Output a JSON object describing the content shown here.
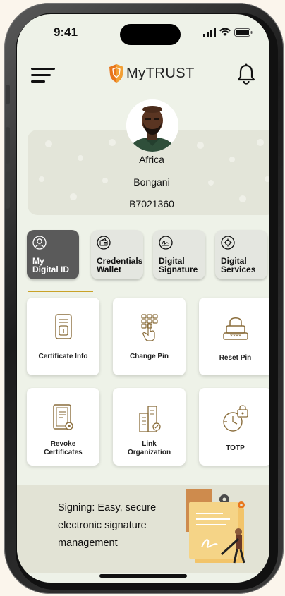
{
  "status_bar": {
    "time": "9:41"
  },
  "header": {
    "app_name": "MyTRUST"
  },
  "profile": {
    "first_name": "Africa",
    "last_name": "Bongani",
    "id_number": "B7021360"
  },
  "tabs": [
    {
      "label_line1": "My",
      "label_line2": "Digital ID",
      "icon": "user-icon",
      "active": true
    },
    {
      "label_line1": "Credentials",
      "label_line2": "Wallet",
      "icon": "wallet-icon",
      "active": false
    },
    {
      "label_line1": "Digital",
      "label_line2": "Signature",
      "icon": "signature-icon",
      "active": false
    },
    {
      "label_line1": "Digital",
      "label_line2": "Services",
      "icon": "services-icon",
      "active": false
    }
  ],
  "actions": [
    {
      "label_line1": "Certificate Info",
      "label_line2": "",
      "icon": "certificate-icon"
    },
    {
      "label_line1": "Change Pin",
      "label_line2": "",
      "icon": "keypad-icon"
    },
    {
      "label_line1": "Reset Pin",
      "label_line2": "",
      "icon": "padlock-icon"
    },
    {
      "label_line1": "Revoke",
      "label_line2": "Certificates",
      "icon": "revoke-document-icon"
    },
    {
      "label_line1": "Link",
      "label_line2": "Organization",
      "icon": "organization-icon"
    },
    {
      "label_line1": "TOTP",
      "label_line2": "",
      "icon": "timer-lock-icon"
    }
  ],
  "banner": {
    "line1": "Signing: Easy, secure",
    "line2": "electronic signature",
    "line3": "management"
  },
  "colors": {
    "accent_gold": "#c9a227",
    "active_tab": "#5a5a5a",
    "background": "#eef2e8",
    "logo_orange": "#e8761c"
  }
}
